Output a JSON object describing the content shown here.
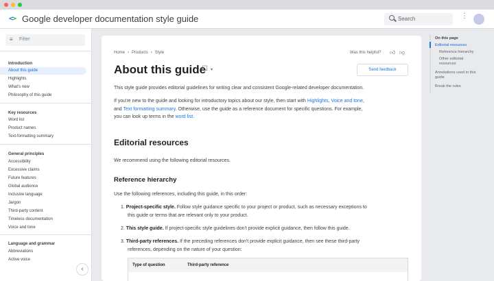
{
  "header": {
    "brand": "Google developer documentation style guide",
    "search_placeholder": "Search"
  },
  "sidebar": {
    "filter_placeholder": "Filter",
    "sections": [
      {
        "title": "Introduction",
        "items": [
          "About this guide",
          "Highlights",
          "What's new",
          "Philosophy of this guide"
        ]
      },
      {
        "title": "Key resources",
        "items": [
          "Word list",
          "Product names",
          "Text-formatting summary"
        ]
      },
      {
        "title": "General principles",
        "items": [
          "Accessibility",
          "Excessive claims",
          "Future features",
          "Global audience",
          "Inclusive language",
          "Jargon",
          "Third-party content",
          "Timeless documentation",
          "Voice and tone"
        ]
      },
      {
        "title": "Language and grammar",
        "items": [
          "Abbreviations",
          "Active voice"
        ]
      }
    ],
    "active_item": "About this guide"
  },
  "breadcrumb": [
    "Home",
    "Products",
    "Style"
  ],
  "helpful_label": "Was this helpful?",
  "page_title": "About this guide",
  "feedback_label": "Send feedback",
  "intro": "This style guide provides editorial guidelines for writing clear and consistent Google-related developer documentation.",
  "para2": {
    "t1": "If you're new to the guide and looking for introductory topics about our style, then start with ",
    "l1": "Highlights",
    "t2": ", ",
    "l2": "Voice and tone",
    "t3": ",",
    "t4": "and ",
    "l3": "Text formatting summary",
    "t5": ". Otherwise, use the guide as a reference document for specific questions. For example,",
    "t6": "you can look up terms in the ",
    "l4": "word list",
    "t7": "."
  },
  "h2_editorial": "Editorial resources",
  "editorial_text": "We recommend using the following editorial resources.",
  "h3_hierarchy": "Reference hierarchy",
  "hierarchy_text": "Use the following references, including this guide, in this order:",
  "list": [
    {
      "num": "1.",
      "bold": "Project-specific style.",
      "line1": " Follow style guidance specific to your project or product, such as necessary exceptions to",
      "line2": "this guide or terms that are relevant only to your product."
    },
    {
      "num": "2.",
      "bold": "This style guide.",
      "line1": " If project-specific style guidelines don't provide explicit guidance, then follow this guide."
    },
    {
      "num": "3.",
      "bold": "Third-party references.",
      "line1": " If the preceding references don't provide explicit guidance, then see these third-party",
      "line2": "references, depending on the nature of your question:"
    }
  ],
  "table_headers": [
    "Type of question",
    "Third-party reference"
  ],
  "toc": {
    "title": "On this page",
    "items": [
      "Editorial resources",
      "Reference hierarchy",
      "Other editorial resources",
      "Annotations used in this guide",
      "Break the rules"
    ],
    "active": "Editorial resources"
  },
  "colors": {
    "accent": "#1a73e8",
    "active_bg": "#e8f0fe"
  }
}
